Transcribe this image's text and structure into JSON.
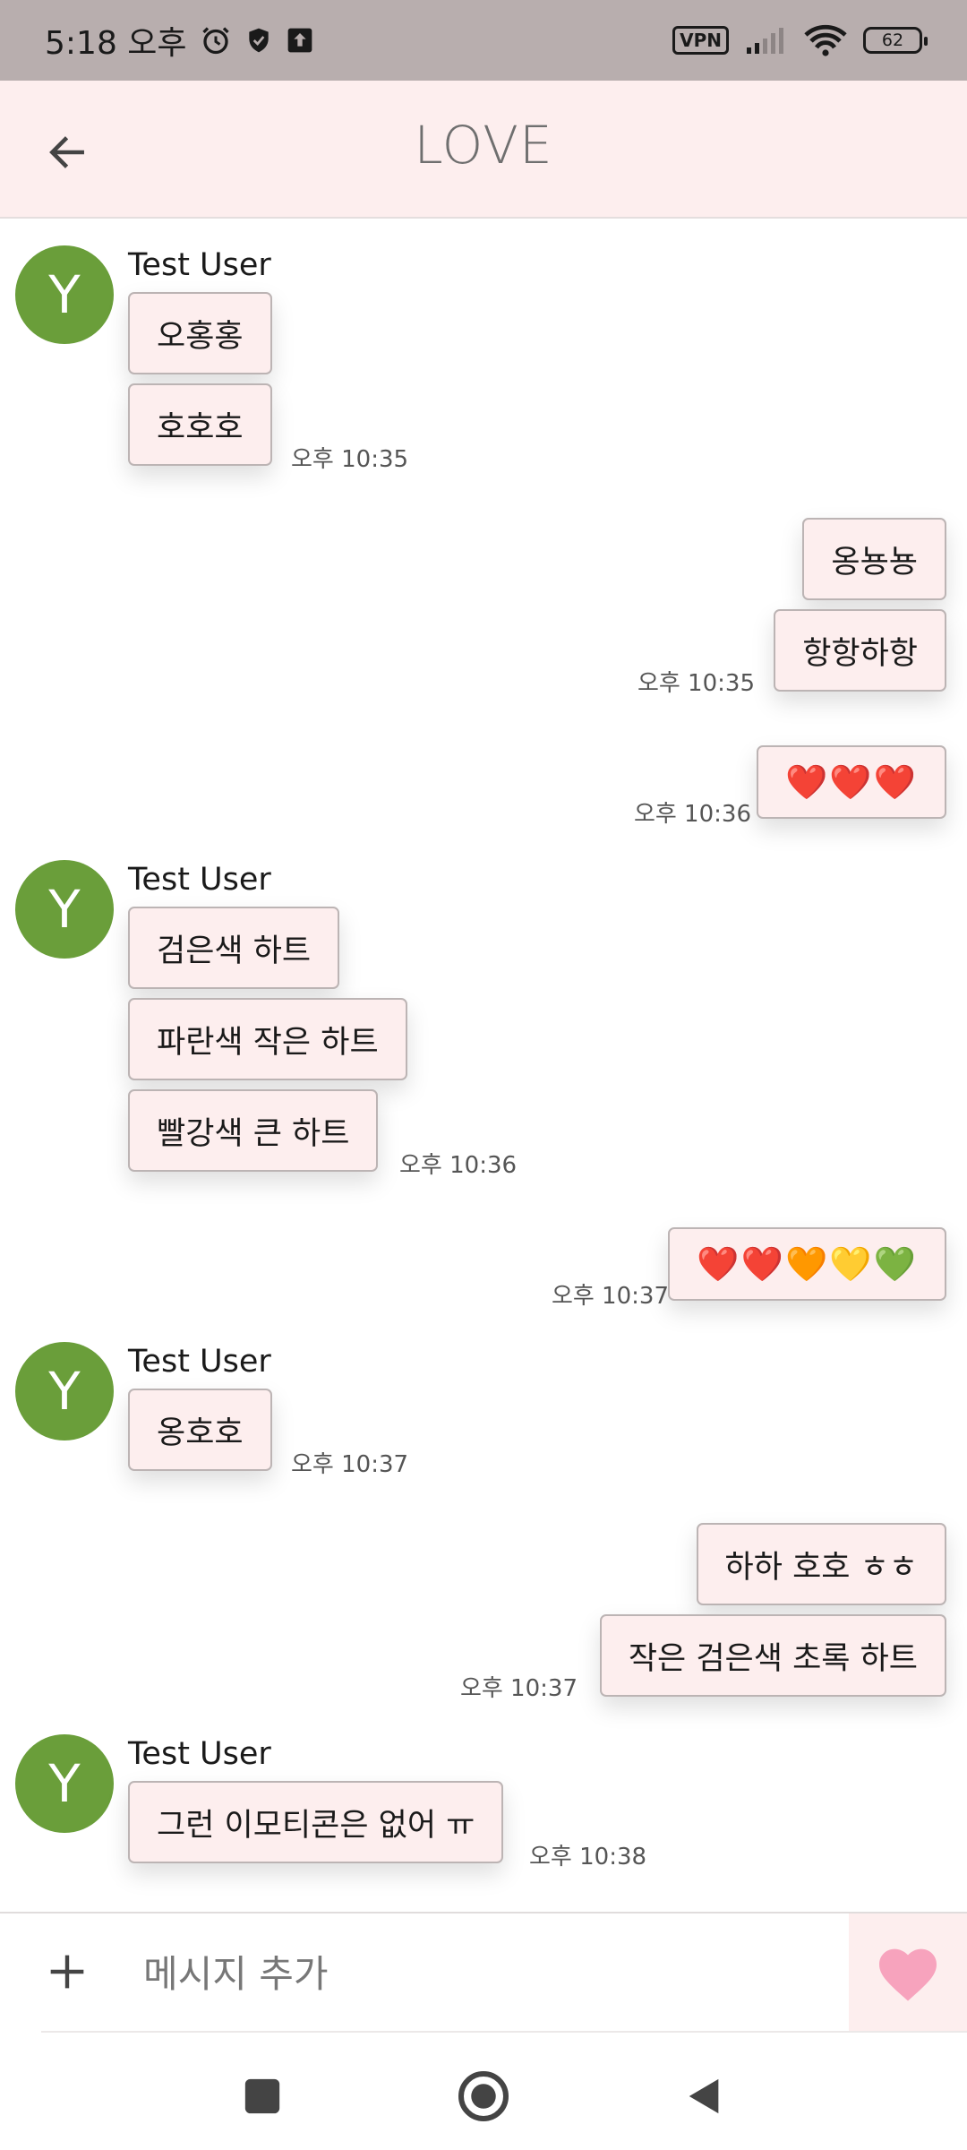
{
  "status_bar": {
    "time": "5:18 오후",
    "vpn": "VPN",
    "battery": "62"
  },
  "header": {
    "title": "LOVE"
  },
  "messages": [
    {
      "sender": "Test User",
      "avatar_letter": "Y",
      "bubbles": [
        "오홍홍",
        "호호호"
      ],
      "time": "오후 10:35"
    },
    {
      "bubbles": [
        "옹뇽뇽",
        "항항하항"
      ],
      "time": "오후 10:35"
    },
    {
      "bubbles": [
        "❤️❤️❤️"
      ],
      "time": "오후 10:36"
    },
    {
      "sender": "Test User",
      "avatar_letter": "Y",
      "bubbles": [
        "검은색 하트",
        "파란색 작은 하트",
        "빨강색 큰 하트"
      ],
      "time": "오후 10:36"
    },
    {
      "bubbles": [
        "❤️❤️🧡💛💚"
      ],
      "time": "오후 10:37"
    },
    {
      "sender": "Test User",
      "avatar_letter": "Y",
      "bubbles": [
        "옹호호"
      ],
      "time": "오후 10:37"
    },
    {
      "bubbles": [
        "하하 호호 ㅎㅎ",
        "작은 검은색 초록 하트"
      ],
      "time": "오후 10:37"
    },
    {
      "sender": "Test User",
      "avatar_letter": "Y",
      "bubbles": [
        "그런 이모티콘은 없어 ㅠ"
      ],
      "time": "오후 10:38"
    }
  ],
  "input": {
    "placeholder": "메시지 추가"
  },
  "icons": {
    "back": "arrow-left-icon",
    "add": "plus-icon",
    "send": "heart-icon",
    "recents": "square-icon",
    "home": "circle-icon",
    "nav_back": "triangle-back-icon"
  },
  "colors": {
    "header_bg": "#fdeeee",
    "avatar": "#6a9e3a",
    "send_heart": "#f7a3bd",
    "status_bar": "#b8aeae"
  }
}
